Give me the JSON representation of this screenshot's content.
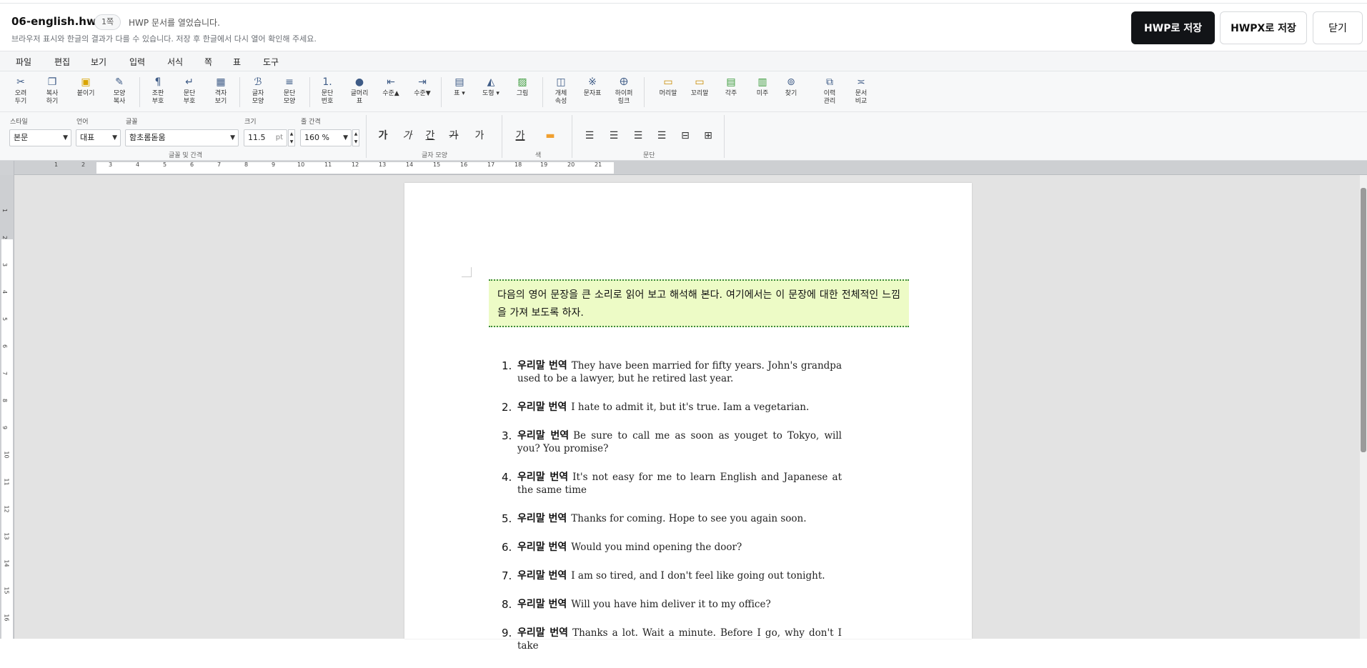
{
  "header": {
    "doc_title": "06-english.hwp",
    "page_count": "1쪽",
    "status": "HWP 문서를 열었습니다.",
    "notice": "브라우저 표시와 한글의 결과가 다를 수 있습니다. 저장 후 한글에서 다시 열어 확인해 주세요.",
    "save_hwp": "HWP로 저장",
    "save_hwpx": "HWPX로 저장",
    "close": "닫기"
  },
  "menu": [
    "파일",
    "편집",
    "보기",
    "입력",
    "서식",
    "쪽",
    "표",
    "도구"
  ],
  "toolbar": [
    {
      "label": "오려\n두기",
      "icon": "scissors-icon"
    },
    {
      "label": "복사\n하기",
      "icon": "copy-icon"
    },
    {
      "label": "붙이기",
      "icon": "paste-icon"
    },
    {
      "label": "모양\n복사",
      "icon": "format-painter-icon"
    },
    {
      "label": "조판\n부호",
      "icon": "pilcrow-icon"
    },
    {
      "label": "문단\n부호",
      "icon": "paragraph-mark-icon"
    },
    {
      "label": "격자\n보기",
      "icon": "grid-icon"
    },
    {
      "label": "글자\n모양",
      "icon": "char-shape-icon"
    },
    {
      "label": "문단\n모양",
      "icon": "para-shape-icon"
    },
    {
      "label": "문단\n번호",
      "icon": "numbering-icon"
    },
    {
      "label": "글머리\n표",
      "icon": "bullet-icon"
    },
    {
      "label": "수준▲",
      "icon": "outdent-icon"
    },
    {
      "label": "수준▼",
      "icon": "indent-icon"
    },
    {
      "label": "표 ▾",
      "icon": "table-icon"
    },
    {
      "label": "도형 ▾",
      "icon": "shape-icon"
    },
    {
      "label": "그림",
      "icon": "image-icon"
    },
    {
      "label": "개체\n속성",
      "icon": "object-props-icon"
    },
    {
      "label": "문자표",
      "icon": "symbol-icon"
    },
    {
      "label": "하이퍼\n링크",
      "icon": "hyperlink-icon"
    },
    {
      "label": "머리말",
      "icon": "header-icon"
    },
    {
      "label": "꼬리말",
      "icon": "footer-icon"
    },
    {
      "label": "각주",
      "icon": "footnote-icon"
    },
    {
      "label": "미주",
      "icon": "endnote-icon"
    },
    {
      "label": "찾기",
      "icon": "binoculars-icon"
    },
    {
      "label": "이력\n관리",
      "icon": "history-icon"
    },
    {
      "label": "문서\n비교",
      "icon": "compare-icon"
    }
  ],
  "format": {
    "style_label": "스타일",
    "style_value": "본문",
    "lang_label": "언어",
    "lang_value": "대표",
    "font_label": "글꼴",
    "font_value": "함초롬돋움",
    "size_label": "크기",
    "size_value": "11.5",
    "size_unit": "pt",
    "spacing_label": "줄 간격",
    "spacing_value": "160 %",
    "group_font": "글꼴 및 간격",
    "group_char": "글자 모양",
    "group_color": "색",
    "group_para": "문단",
    "bold_glyph": "가",
    "italic_glyph": "가",
    "underline_glyph": "간",
    "strike_glyph": "가",
    "super_glyph": "가",
    "color_glyph": "가"
  },
  "ruler": {
    "h": [
      "1",
      "2",
      "3",
      "4",
      "5",
      "6",
      "7",
      "8",
      "9",
      "10",
      "11",
      "12",
      "13",
      "14",
      "15",
      "16",
      "17",
      "18",
      "19",
      "20",
      "21"
    ],
    "v": [
      "1",
      "2",
      "3",
      "4",
      "5",
      "6",
      "7",
      "8",
      "9",
      "10",
      "11",
      "12",
      "13",
      "14",
      "15",
      "16"
    ]
  },
  "document": {
    "callout": "다음의 영어 문장을 큰 소리로 읽어 보고 해석해 본다. 여기에서는 이 문장에 대한 전체적인 느낌을 가져 보도록 하자.",
    "items": [
      {
        "num": "1.",
        "kr": "우리말 번역",
        "en": "They have been married for fifty years. John's grandpa used to be a lawyer, but he retired last year."
      },
      {
        "num": "2.",
        "kr": "우리말 번역",
        "en": "I hate to admit it, but it's true. Iam a vegetarian."
      },
      {
        "num": "3.",
        "kr": "우리말 번역",
        "en": "Be sure to call me as soon as youget to Tokyo, will you? You promise?"
      },
      {
        "num": "4.",
        "kr": "우리말 번역",
        "en": "It's not easy for me to learn English and Japanese at the same time"
      },
      {
        "num": "5.",
        "kr": "우리말 번역",
        "en": "Thanks for coming. Hope to see you again soon."
      },
      {
        "num": "6.",
        "kr": "우리말 번역",
        "en": "Would you mind opening the door?"
      },
      {
        "num": "7.",
        "kr": "우리말 번역",
        "en": "I am so tired, and I don't feel like going out tonight."
      },
      {
        "num": "8.",
        "kr": "우리말 번역",
        "en": "Will you have him deliver it to my office?"
      },
      {
        "num": "9.",
        "kr": "우리말 번역",
        "en": "Thanks a lot. Wait a minute. Before I go, why don't I take"
      }
    ]
  }
}
